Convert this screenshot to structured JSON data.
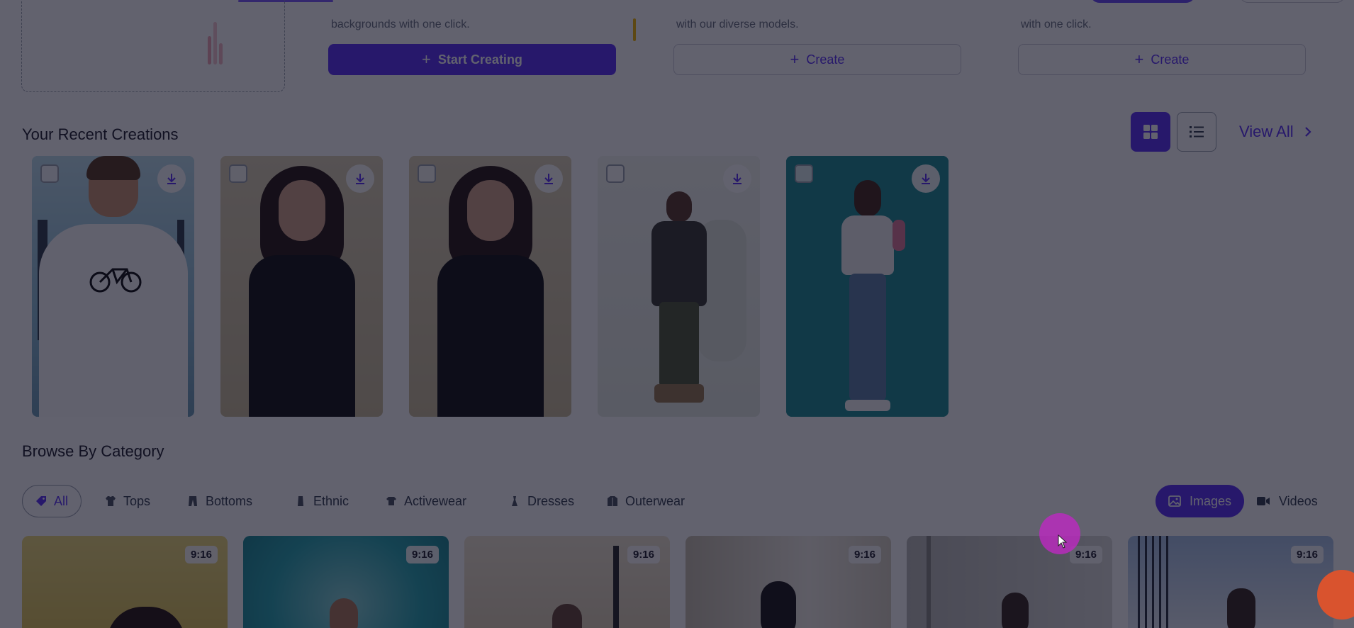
{
  "features": [
    {
      "desc": "backgrounds with one click.",
      "button": "Start Creating",
      "style": "primary"
    },
    {
      "desc": "with our diverse models.",
      "button": "Create",
      "style": "outline"
    },
    {
      "desc": "with one click.",
      "button": "Create",
      "style": "outline"
    }
  ],
  "recent": {
    "title": "Your Recent Creations",
    "view_all": "View All",
    "view_modes": [
      "grid-icon",
      "list-icon"
    ],
    "active_view": "grid",
    "cards": [
      {
        "subject": "man in white t-shirt with bicycle print",
        "bg": "#a7d3e5"
      },
      {
        "subject": "woman in black lace top",
        "bg": "#d6c9a8"
      },
      {
        "subject": "woman in black lace top",
        "bg": "#d6c9a8"
      },
      {
        "subject": "woman in olive graphic tee and cargo pants",
        "bg": "#eef2ea"
      },
      {
        "subject": "woman in raglan tee and jeans",
        "bg": "#1f8a8c"
      }
    ]
  },
  "browse": {
    "title": "Browse By Category",
    "categories": [
      {
        "label": "All",
        "icon": "tag-icon",
        "active": true
      },
      {
        "label": "Tops",
        "icon": "shirt-icon",
        "active": false
      },
      {
        "label": "Bottoms",
        "icon": "pants-icon",
        "active": false
      },
      {
        "label": "Ethnic",
        "icon": "ethnic-icon",
        "active": false
      },
      {
        "label": "Activewear",
        "icon": "activewear-icon",
        "active": false
      },
      {
        "label": "Dresses",
        "icon": "dress-icon",
        "active": false
      },
      {
        "label": "Outerwear",
        "icon": "jacket-icon",
        "active": false
      }
    ],
    "media": {
      "images": "Images",
      "videos": "Videos",
      "active": "images"
    },
    "tiles": [
      {
        "ratio": "9:16",
        "bg": "#e9d36a"
      },
      {
        "ratio": "9:16",
        "bg": "#2aa7b0"
      },
      {
        "ratio": "9:16",
        "bg": "#e8dcc4"
      },
      {
        "ratio": "9:16",
        "bg": "#d9d2c2"
      },
      {
        "ratio": "9:16",
        "bg": "#cfcfcc"
      },
      {
        "ratio": "9:16",
        "bg": "#b9cde6"
      }
    ]
  },
  "colors": {
    "accent": "#5b34f5",
    "overlay": "rgba(10,10,28,0.64)"
  }
}
